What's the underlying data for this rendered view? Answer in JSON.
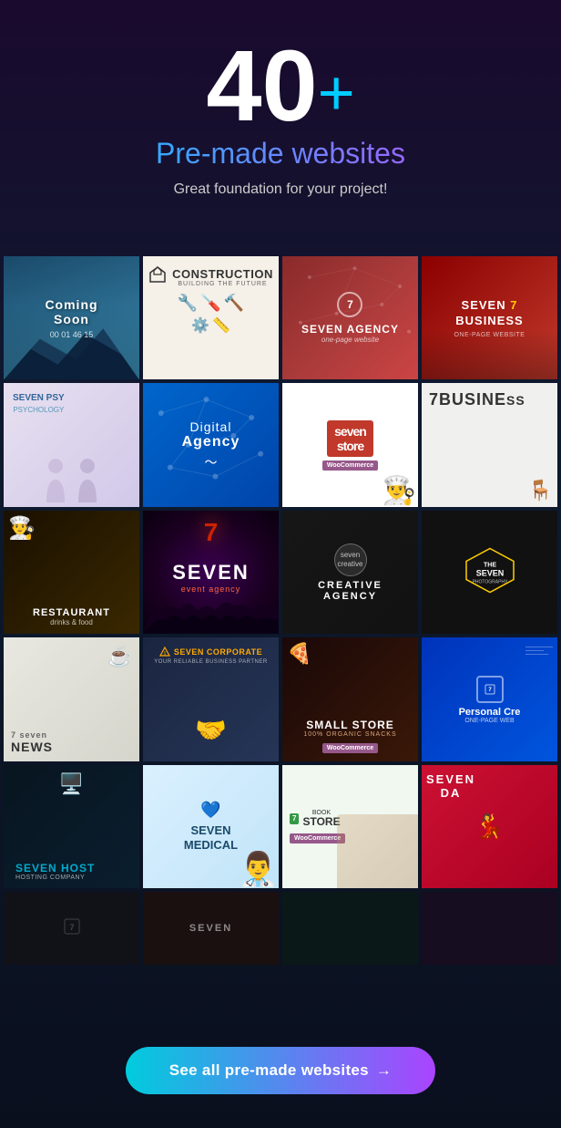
{
  "hero": {
    "number": "40",
    "plus": "+",
    "subtitle": "Pre-made websites",
    "tagline": "Great foundation for your project!"
  },
  "cta": {
    "label": "See all pre-made websites",
    "arrow": "→"
  },
  "tiles": [
    {
      "id": "coming-soon",
      "label": "Coming Soon",
      "sublabel": "00 01 46 15",
      "style": "coming-soon"
    },
    {
      "id": "construction",
      "label": "CONSTRUCTION",
      "sublabel": "BUILDING THE FUTURE",
      "style": "construction"
    },
    {
      "id": "seven-agency",
      "label": "SEVEN AGENCY",
      "sublabel": "one-page website",
      "style": "seven-agency"
    },
    {
      "id": "seven-business",
      "label": "SEVEN 7 BUSINESS",
      "sublabel": "ONE-PAGE WEBSITE",
      "style": "seven-business"
    },
    {
      "id": "seven-psy",
      "label": "SEVEN PSY",
      "sublabel": "PSYCHOLOGY",
      "style": "seven-psy"
    },
    {
      "id": "digital-agency",
      "label": "Digital Agency",
      "sublabel": "",
      "style": "digital-agency"
    },
    {
      "id": "seven-store",
      "label": "seven store",
      "sublabel": "WooCommerce",
      "style": "seven-store"
    },
    {
      "id": "7business",
      "label": "7BUSINESS",
      "sublabel": "",
      "style": "7business"
    },
    {
      "id": "restaurant",
      "label": "RESTAURANT",
      "sublabel": "drinks & food",
      "style": "restaurant"
    },
    {
      "id": "seven-event",
      "label": "SEVEN event agency",
      "sublabel": "",
      "style": "seven-event"
    },
    {
      "id": "creative-agency",
      "label": "CREATIVE AGENCY",
      "sublabel": "",
      "style": "creative-agency"
    },
    {
      "id": "the-seven",
      "label": "THE SEVEN PHOTOGRAPHY",
      "sublabel": "",
      "style": "the-seven"
    },
    {
      "id": "seven-news",
      "label": "7 seven NEWS",
      "sublabel": "",
      "style": "seven-news"
    },
    {
      "id": "seven-corporate",
      "label": "SEVEN CORPORATE",
      "sublabel": "YOUR RELIABLE BUSINESS PARTNER",
      "style": "seven-corporate"
    },
    {
      "id": "small-store",
      "label": "SMALL STORE",
      "sublabel": "100% ORGANIC SNACKS",
      "style": "small-store"
    },
    {
      "id": "personal-cre",
      "label": "Personal Cre",
      "sublabel": "ONE-PAGE WEB",
      "style": "personal-cre"
    },
    {
      "id": "seven-host",
      "label": "SEVEN HOST",
      "sublabel": "HOSTING COMPANY",
      "style": "seven-host"
    },
    {
      "id": "seven-medical",
      "label": "SEVEN MEDICAL",
      "sublabel": "",
      "style": "seven-medical"
    },
    {
      "id": "book-store",
      "label": "BOOK STORE",
      "sublabel": "WooCommerce",
      "style": "book-store"
    },
    {
      "id": "seven-da",
      "label": "SEVEN DA",
      "sublabel": "",
      "style": "seven-da"
    },
    {
      "id": "bottom1",
      "label": "",
      "sublabel": "",
      "style": "bottom1"
    },
    {
      "id": "bottom2",
      "label": "SEVEN",
      "sublabel": "",
      "style": "bottom2"
    },
    {
      "id": "bottom3",
      "label": "",
      "sublabel": "",
      "style": "bottom3"
    },
    {
      "id": "bottom4",
      "label": "",
      "sublabel": "",
      "style": "bottom4"
    }
  ]
}
